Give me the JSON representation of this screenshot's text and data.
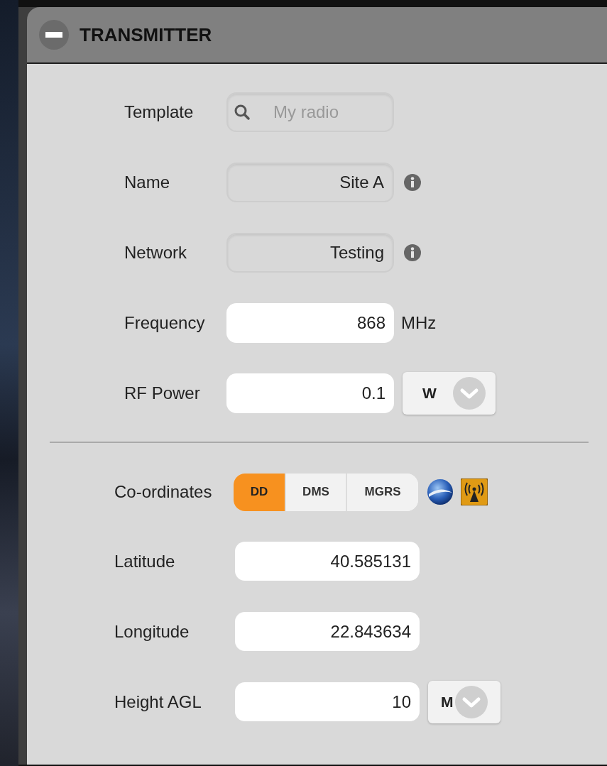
{
  "panel": {
    "title": "TRANSMITTER",
    "expanded": true
  },
  "fields": [
    {
      "label": "Template",
      "kind": "search",
      "placeholder": "My radio"
    },
    {
      "label": "Name",
      "kind": "readonly",
      "value": "Site A",
      "info": true
    },
    {
      "label": "Network",
      "kind": "readonly",
      "value": "Testing",
      "info": true
    },
    {
      "label": "Frequency",
      "kind": "input",
      "value": "868",
      "unit": "MHz"
    },
    {
      "label": "RF Power",
      "kind": "input",
      "value": "0.1",
      "unit_select": "W"
    }
  ],
  "coordinates": {
    "label": "Co-ordinates",
    "formats": [
      {
        "label": "DD",
        "selected": true
      },
      {
        "label": "DMS",
        "selected": false
      },
      {
        "label": "MGRS",
        "selected": false
      }
    ]
  },
  "position_fields": [
    {
      "label": "Latitude",
      "value": "40.585131"
    },
    {
      "label": "Longitude",
      "value": "22.843634"
    },
    {
      "label": "Height AGL",
      "value": "10",
      "unit_select": "M"
    }
  ]
}
